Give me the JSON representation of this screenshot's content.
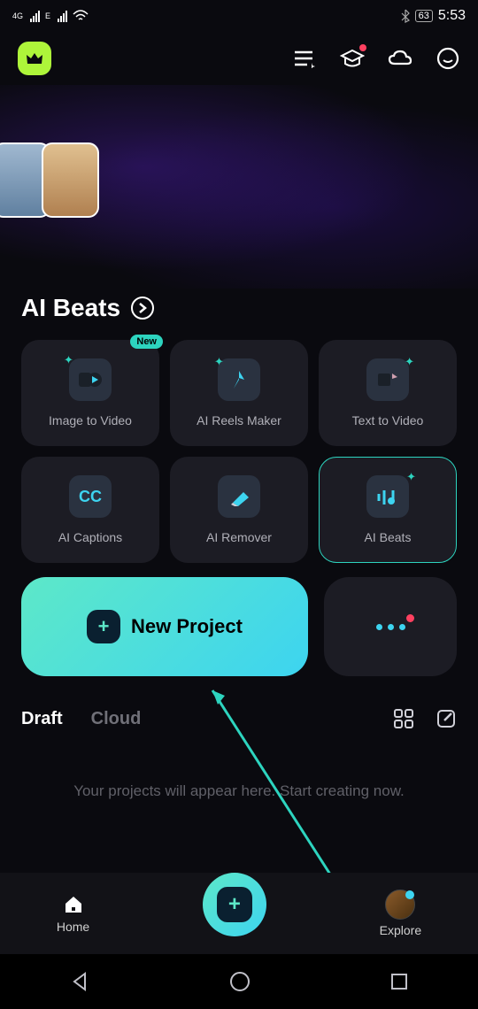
{
  "status": {
    "net1": "4G",
    "net2": "E",
    "battery": "63",
    "time": "5:53"
  },
  "section_title": "AI Beats",
  "features": [
    {
      "label": "Image to Video",
      "badge": "New"
    },
    {
      "label": "AI Reels Maker"
    },
    {
      "label": "Text to Video"
    },
    {
      "label": "AI Captions"
    },
    {
      "label": "AI Remover"
    },
    {
      "label": "AI Beats"
    }
  ],
  "new_project_label": "New Project",
  "tabs": {
    "draft": "Draft",
    "cloud": "Cloud"
  },
  "empty_message": "Your projects will appear here. Start creating now.",
  "nav": {
    "home": "Home",
    "explore": "Explore"
  }
}
